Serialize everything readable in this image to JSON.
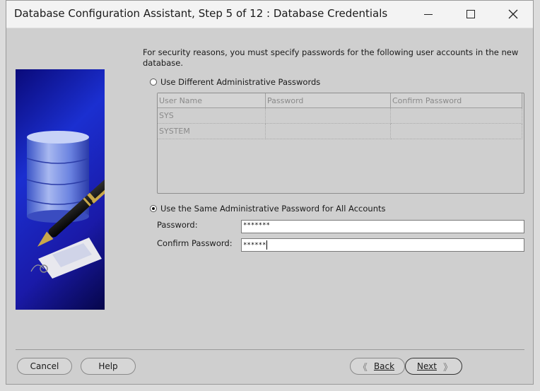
{
  "window": {
    "title": "Database Configuration Assistant, Step 5 of 12 : Database Credentials"
  },
  "main": {
    "description": "For security reasons, you must specify passwords for the following user accounts in the new database.",
    "option_different": "Use Different Administrative Passwords",
    "option_same": "Use the Same Administrative Password for All Accounts",
    "selected_option": "same",
    "table": {
      "columns": [
        "User Name",
        "Password",
        "Confirm Password"
      ],
      "rows": [
        [
          "SYS",
          "",
          ""
        ],
        [
          "SYSTEM",
          "",
          ""
        ]
      ]
    },
    "password_label": "Password:",
    "password_value": "*******",
    "confirm_label": "Confirm Password:",
    "confirm_value": "******"
  },
  "footer": {
    "cancel": "Cancel",
    "help": "Help",
    "back_chevron": "《",
    "back": "Back",
    "next": "Next",
    "next_chevron": "》"
  },
  "icons": {
    "minimize": "minimize-icon",
    "maximize": "maximize-icon",
    "close": "close-icon",
    "illustration": "database-pen-illustration"
  },
  "colors": {
    "accent_blue": "#1b2fd0",
    "window_bg": "#cfcfcf"
  }
}
